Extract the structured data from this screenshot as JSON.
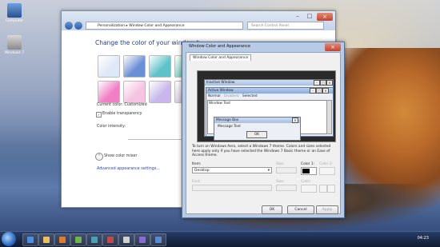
{
  "desktop": {
    "icons": [
      {
        "label": "Computer"
      },
      {
        "label": "Windows 7"
      }
    ]
  },
  "personalization": {
    "address": "Personalization  ▸  Window Color and Appearance",
    "search_placeholder": "Search Control Panel",
    "heading": "Change the color of your window b...",
    "current_color": "Current color: Customized",
    "enable_transparency": "Enable transparency",
    "color_intensity": "Color intensity:",
    "show_color_mixer": "Show color mixer",
    "advanced_link": "Advanced appearance settings...",
    "swatch_colors": [
      "#dfe8f6",
      "#6a8fd6",
      "#5ec2c8",
      "#7ed0c0",
      "#9fd6ee",
      "#f27fc6",
      "#f6c3e2",
      "#c8b6ec",
      "#d2c8de",
      "#e0e0e0"
    ]
  },
  "dialog": {
    "title": "Window Color and Appearance",
    "tab": "Window Color and Appearance",
    "preview": {
      "inactive_window": "Inactive Window",
      "active_window": "Active Window",
      "menu_normal": "Normal",
      "menu_disabled": "Disabled",
      "menu_selected": "Selected",
      "window_text": "Window Text",
      "message_box": "Message Box",
      "message_text": "Message Text",
      "ok": "OK"
    },
    "info_text": "To turn on Windows Aero, select a Windows 7 theme. Colors and sizes selected here apply only if you have selected the Windows 7 Basic theme or an Ease of Access theme.",
    "item_label": "Item:",
    "item_value": "Desktop",
    "size_label": "Size:",
    "color1_label": "Color 1:",
    "color2_label": "Color 2:",
    "font_label": "Font:",
    "font_size_label": "Size:",
    "font_color_label": "Color:",
    "ok_button": "OK",
    "cancel_button": "Cancel",
    "apply_button": "Apply"
  },
  "taskbar": {
    "clock": "04:23"
  }
}
